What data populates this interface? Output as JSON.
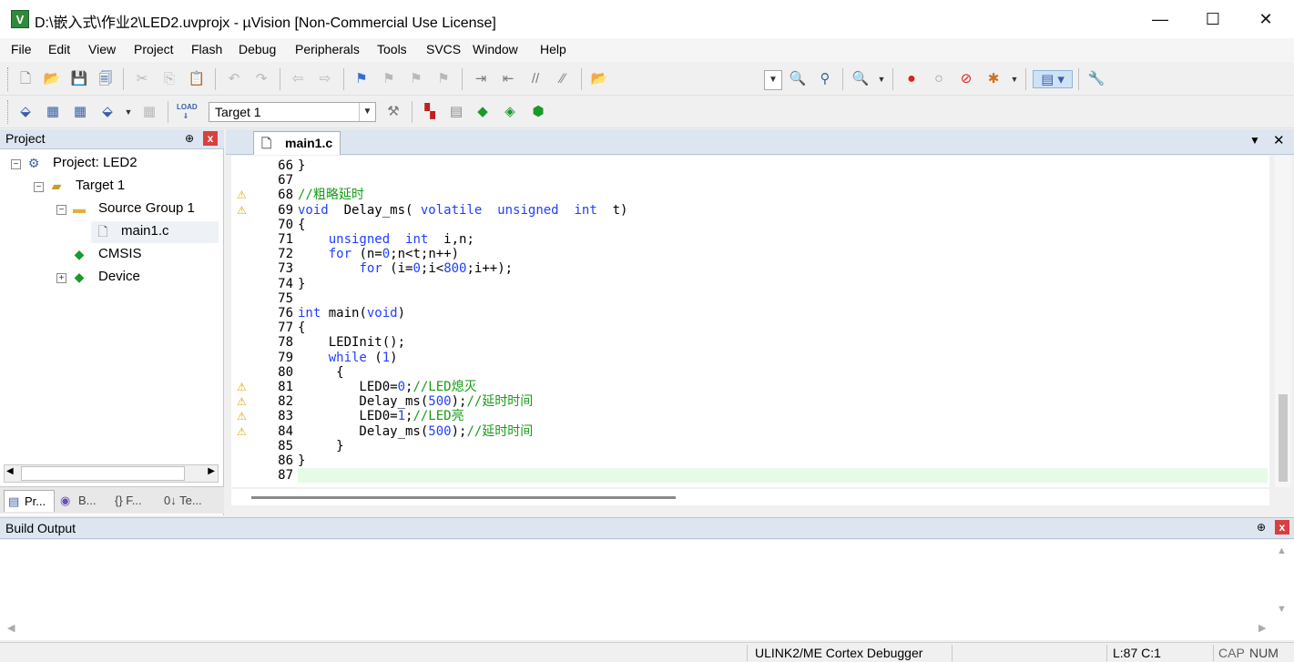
{
  "window": {
    "app_icon": "V",
    "title": "D:\\嵌入式\\作业2\\LED2.uvprojx - µVision  [Non-Commercial Use License]",
    "minimize_glyph": "—",
    "maximize_glyph": "☐",
    "close_glyph": "✕"
  },
  "menu": [
    "File",
    "Edit",
    "View",
    "Project",
    "Flash",
    "Debug",
    "Peripherals",
    "Tools",
    "SVCS",
    "Window",
    "Help"
  ],
  "toolbar": {
    "target_combo": "Target 1",
    "load_label": "LOAD"
  },
  "project_panel": {
    "title": "Project",
    "pin_glyph": "⊕",
    "close_glyph": "x",
    "tree": [
      {
        "label": "Project: LED2",
        "icon": "project-icon",
        "expander": "−"
      },
      {
        "label": "Target 1",
        "icon": "target-icon",
        "expander": "−"
      },
      {
        "label": "Source Group 1",
        "icon": "folder-icon",
        "expander": "−"
      },
      {
        "label": "main1.c",
        "icon": "file-icon",
        "expander": ""
      },
      {
        "label": "CMSIS",
        "icon": "component-icon",
        "expander": ""
      },
      {
        "label": "Device",
        "icon": "component-icon",
        "expander": "+"
      }
    ],
    "tabs": [
      "Pr...",
      "B...",
      "{} F...",
      "0↓ Te..."
    ]
  },
  "editor": {
    "tab_label": "main1.c",
    "lines": [
      {
        "n": "66",
        "warn": false,
        "text": "}"
      },
      {
        "n": "67",
        "warn": false,
        "text": ""
      },
      {
        "n": "68",
        "warn": true,
        "text": "//粗略延时"
      },
      {
        "n": "69",
        "warn": true,
        "text": "void  Delay_ms( volatile  unsigned  int  t)"
      },
      {
        "n": "70",
        "warn": false,
        "text": "{"
      },
      {
        "n": "71",
        "warn": false,
        "text": "    unsigned  int  i,n;"
      },
      {
        "n": "72",
        "warn": false,
        "text": "    for (n=0;n<t;n++)"
      },
      {
        "n": "73",
        "warn": false,
        "text": "        for (i=0;i<800;i++);"
      },
      {
        "n": "74",
        "warn": false,
        "text": "}"
      },
      {
        "n": "75",
        "warn": false,
        "text": ""
      },
      {
        "n": "76",
        "warn": false,
        "text": "int main(void)"
      },
      {
        "n": "77",
        "warn": false,
        "text": "{"
      },
      {
        "n": "78",
        "warn": false,
        "text": "    LEDInit();"
      },
      {
        "n": "79",
        "warn": false,
        "text": "    while (1)"
      },
      {
        "n": "80",
        "warn": false,
        "text": "     {"
      },
      {
        "n": "81",
        "warn": true,
        "text": "        LED0=0;//LED熄灭"
      },
      {
        "n": "82",
        "warn": true,
        "text": "        Delay_ms(500);//延时时间"
      },
      {
        "n": "83",
        "warn": true,
        "text": "        LED0=1;//LED亮"
      },
      {
        "n": "84",
        "warn": true,
        "text": "        Delay_ms(500);//延时时间"
      },
      {
        "n": "85",
        "warn": false,
        "text": "     }"
      },
      {
        "n": "86",
        "warn": false,
        "text": "}"
      },
      {
        "n": "87",
        "warn": false,
        "text": ""
      }
    ]
  },
  "build_output": {
    "title": "Build Output",
    "pin_glyph": "⊕",
    "close_glyph": "x"
  },
  "status": {
    "debugger": "ULINK2/ME Cortex Debugger",
    "position": "L:87 C:1",
    "caps": "CAP",
    "num": "NUM"
  },
  "colors": {
    "keyword": "#1f3fff",
    "comment": "#169b16",
    "current_line": "#e6fbe6",
    "panel_header": "#dde6f0"
  }
}
